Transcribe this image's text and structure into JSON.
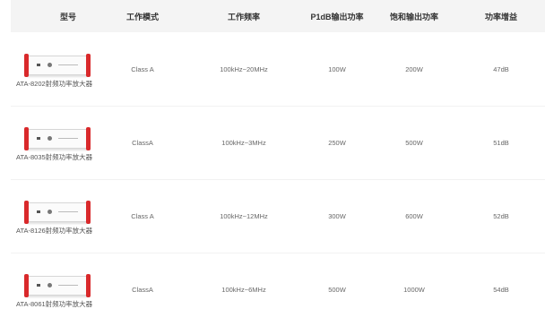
{
  "colors": {
    "accent": "#d9292b",
    "header_bg": "#f4f4f4",
    "text": "#666666"
  },
  "headers": [
    "型号",
    "工作模式",
    "工作频率",
    "P1dB输出功率",
    "饱和输出功率",
    "功率增益"
  ],
  "rows": [
    {
      "model": "ATA-8202射频功率放大器",
      "mode": "Class A",
      "freq": "100kHz~20MHz",
      "p1db": "100W",
      "sat": "200W",
      "gain": "47dB"
    },
    {
      "model": "ATA-8035射频功率放大器",
      "mode": "ClassA",
      "freq": "100kHz~3MHz",
      "p1db": "250W",
      "sat": "500W",
      "gain": "51dB"
    },
    {
      "model": "ATA-8126射频功率放大器",
      "mode": "Class A",
      "freq": "100kHz~12MHz",
      "p1db": "300W",
      "sat": "600W",
      "gain": "52dB"
    },
    {
      "model": "ATA-8061射频功率放大器",
      "mode": "ClassA",
      "freq": "100kHz~6MHz",
      "p1db": "500W",
      "sat": "1000W",
      "gain": "54dB"
    }
  ]
}
